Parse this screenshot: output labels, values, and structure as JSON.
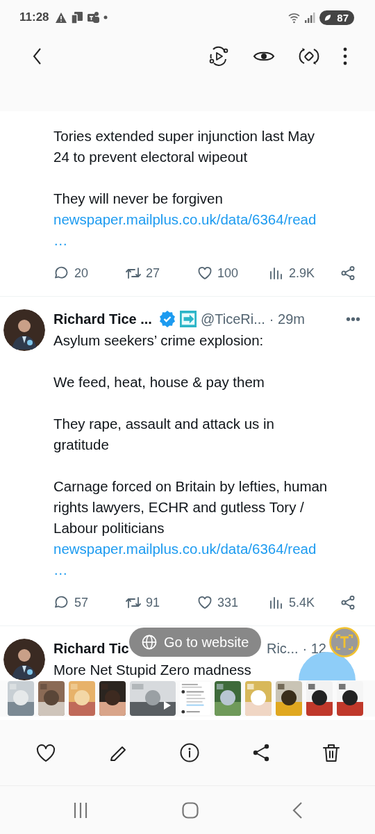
{
  "status_bar": {
    "time": "11:28",
    "battery": "87"
  },
  "tweets": [
    {
      "paragraphs": [
        [
          "Tories extended super injunction last May",
          "24 to prevent electoral wipeout"
        ],
        [
          "They will never be forgiven"
        ]
      ],
      "link": " newspaper.mailplus.co.uk/data/6364/read",
      "link_more": "…",
      "actions": [
        {
          "kind": "reply",
          "count": "20"
        },
        {
          "kind": "retweet",
          "count": "27"
        },
        {
          "kind": "like",
          "count": "100"
        },
        {
          "kind": "views",
          "count": "2.9K"
        },
        {
          "kind": "share"
        }
      ]
    },
    {
      "author": "Richard Tice ...",
      "verified": true,
      "handle": "@TiceRi...",
      "time": "· 29m",
      "menu": "•••",
      "paragraphs": [
        [
          "Asylum seekers’ crime explosion:"
        ],
        [
          "We feed, heat, house & pay them"
        ],
        [
          "They rape, assault and attack us in",
          "gratitude"
        ],
        [
          "Carnage forced on Britain by lefties, human",
          "rights lawyers, ECHR and gutless Tory /",
          "Labour politicians"
        ]
      ],
      "link": "newspaper.mailplus.co.uk/data/6364/read",
      "link_more": "…",
      "actions": [
        {
          "kind": "reply",
          "count": "57"
        },
        {
          "kind": "retweet",
          "count": "91"
        },
        {
          "kind": "like",
          "count": "331"
        },
        {
          "kind": "views",
          "count": "5.4K"
        },
        {
          "kind": "share"
        }
      ]
    },
    {
      "author": "Richard Tic",
      "handle": "Ric...",
      "time": "· 12",
      "paragraphs": [
        [
          "More Net Stupid Zero madness"
        ]
      ]
    }
  ],
  "go_to_website": "Go to website",
  "thumbnails": [
    {
      "kind": "picture"
    },
    {
      "kind": "picture"
    },
    {
      "kind": "picture"
    },
    {
      "kind": "picture"
    },
    {
      "kind": "video"
    },
    {
      "kind": "screenshot"
    },
    {
      "kind": "picture"
    },
    {
      "kind": "picture"
    },
    {
      "kind": "picture"
    },
    {
      "kind": "picture"
    },
    {
      "kind": "picture"
    }
  ]
}
